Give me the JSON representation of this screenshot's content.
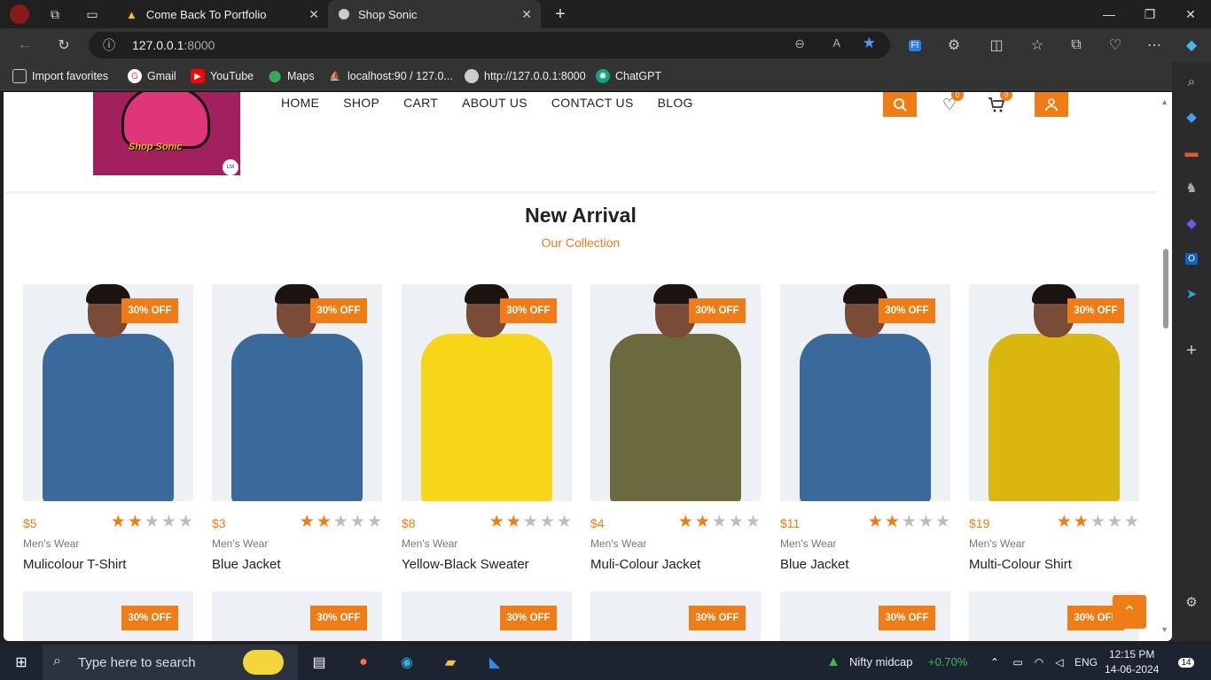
{
  "browser": {
    "tabs": [
      {
        "title": "Come Back To Portfolio",
        "active": false
      },
      {
        "title": "Shop Sonic",
        "active": true
      }
    ],
    "url_host": "127.0.0.1",
    "url_port": ":8000",
    "favorites": [
      "Import favorites",
      "Gmail",
      "YouTube",
      "Maps",
      "localhost:90 / 127.0...",
      "http://127.0.0.1:8000",
      "ChatGPT"
    ]
  },
  "site": {
    "logo_text": "Shop Sonic",
    "logo_badge": "LM",
    "menu": [
      "HOME",
      "SHOP",
      "CART",
      "ABOUT US",
      "CONTACT US",
      "BLOG"
    ],
    "wishlist_count": "0",
    "cart_count": "0"
  },
  "section": {
    "title": "New Arrival",
    "subtitle": "Our Collection"
  },
  "products": [
    {
      "price": "$5",
      "rating": 2,
      "category": "Men's Wear",
      "name": "Mulicolour T-Shirt",
      "discount": "30% OFF",
      "jacket": "#3a6a9c"
    },
    {
      "price": "$3",
      "rating": 2,
      "category": "Men's Wear",
      "name": "Blue Jacket",
      "discount": "30% OFF",
      "jacket": "#3a6a9c"
    },
    {
      "price": "$8",
      "rating": 2,
      "category": "Men's Wear",
      "name": "Yellow-Black Sweater",
      "discount": "30% OFF",
      "jacket": "#f6d617"
    },
    {
      "price": "$4",
      "rating": 2,
      "category": "Men's Wear",
      "name": "Muli-Colour Jacket",
      "discount": "30% OFF",
      "jacket": "#6b6a3e"
    },
    {
      "price": "$11",
      "rating": 2,
      "category": "Men's Wear",
      "name": "Blue Jacket",
      "discount": "30% OFF",
      "jacket": "#3a6a9c"
    },
    {
      "price": "$19",
      "rating": 2,
      "category": "Men's Wear",
      "name": "Multi-Colour Shirt",
      "discount": "30% OFF",
      "jacket": "#d9b70f"
    }
  ],
  "row2_discount": "30% OFF",
  "taskbar": {
    "search_placeholder": "Type here to search",
    "ticker_name": "Nifty midcap",
    "ticker_change": "+0.70%",
    "lang": "ENG",
    "time": "12:15 PM",
    "date": "14-06-2024",
    "notifications": "14"
  },
  "colors": {
    "accent": "#f07c15"
  }
}
